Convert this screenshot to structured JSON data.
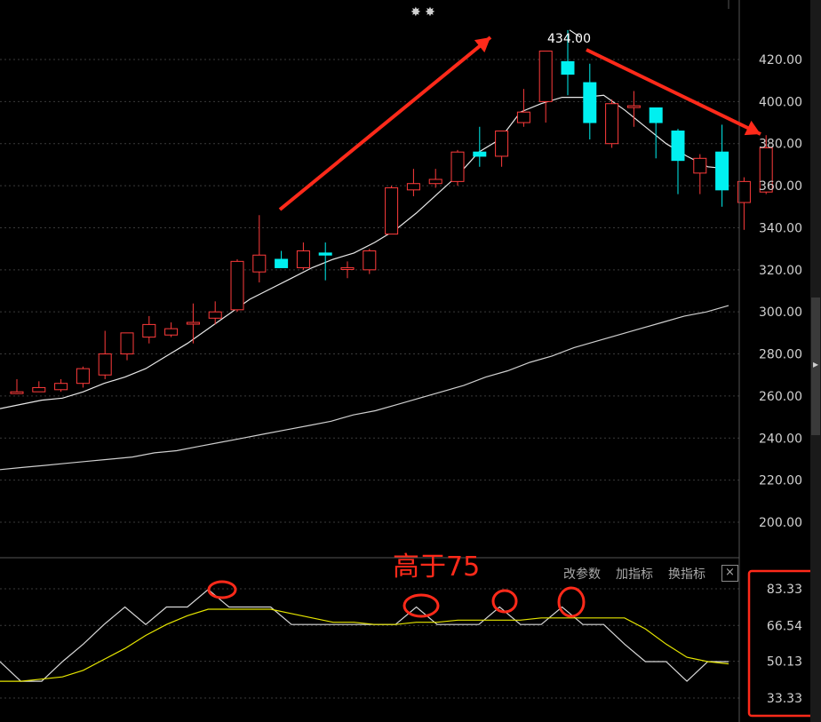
{
  "chart_data": [
    {
      "type": "candlestick",
      "ylim": [
        180,
        440
      ],
      "y_ticks": [
        "420.00",
        "400.00",
        "380.00",
        "360.00",
        "340.00",
        "320.00",
        "300.00",
        "280.00",
        "260.00",
        "240.00",
        "220.00",
        "200.00"
      ],
      "max_label": "434.00",
      "candles": [
        {
          "o": 262,
          "h": 268,
          "l": 261,
          "c": 262
        },
        {
          "o": 262,
          "h": 267,
          "l": 262,
          "c": 264
        },
        {
          "o": 263,
          "h": 268,
          "l": 262,
          "c": 266
        },
        {
          "o": 266,
          "h": 274,
          "l": 264,
          "c": 273
        },
        {
          "o": 270,
          "h": 291,
          "l": 268,
          "c": 280
        },
        {
          "o": 280,
          "h": 288,
          "l": 277,
          "c": 290
        },
        {
          "o": 288,
          "h": 298,
          "l": 285,
          "c": 294
        },
        {
          "o": 289,
          "h": 295,
          "l": 288,
          "c": 292
        },
        {
          "o": 295,
          "h": 304,
          "l": 285,
          "c": 295
        },
        {
          "o": 297,
          "h": 305,
          "l": 294,
          "c": 300
        },
        {
          "o": 301,
          "h": 325,
          "l": 300,
          "c": 324
        },
        {
          "o": 319,
          "h": 346,
          "l": 314,
          "c": 327
        },
        {
          "o": 325,
          "h": 329,
          "l": 321,
          "c": 321
        },
        {
          "o": 321,
          "h": 333,
          "l": 320,
          "c": 329
        },
        {
          "o": 328,
          "h": 333,
          "l": 315,
          "c": 327
        },
        {
          "o": 321,
          "h": 324,
          "l": 316,
          "c": 321
        },
        {
          "o": 320,
          "h": 330,
          "l": 318,
          "c": 329
        },
        {
          "o": 337,
          "h": 360,
          "l": 337,
          "c": 359
        },
        {
          "o": 358,
          "h": 368,
          "l": 355,
          "c": 361
        },
        {
          "o": 361,
          "h": 368,
          "l": 359,
          "c": 363
        },
        {
          "o": 362,
          "h": 377,
          "l": 360,
          "c": 376
        },
        {
          "o": 376,
          "h": 388,
          "l": 369,
          "c": 374
        },
        {
          "o": 374,
          "h": 386,
          "l": 369,
          "c": 386
        },
        {
          "o": 390,
          "h": 406,
          "l": 388,
          "c": 395
        },
        {
          "o": 400,
          "h": 424,
          "l": 390,
          "c": 424
        },
        {
          "o": 419,
          "h": 434,
          "l": 403,
          "c": 413
        },
        {
          "o": 409,
          "h": 418,
          "l": 382,
          "c": 390
        },
        {
          "o": 380,
          "h": 401,
          "l": 378,
          "c": 399
        },
        {
          "o": 398,
          "h": 405,
          "l": 388,
          "c": 398
        },
        {
          "o": 397,
          "h": 397,
          "l": 373,
          "c": 390
        },
        {
          "o": 386,
          "h": 387,
          "l": 356,
          "c": 372
        },
        {
          "o": 366,
          "h": 375,
          "l": 356,
          "c": 373
        },
        {
          "o": 376,
          "h": 389,
          "l": 350,
          "c": 358
        },
        {
          "o": 352,
          "h": 364,
          "l": 339,
          "c": 362
        },
        {
          "o": 357,
          "h": 384,
          "l": 356,
          "c": 378
        }
      ],
      "ma_short": [
        254,
        256,
        258,
        259,
        262,
        266,
        269,
        273,
        279,
        285,
        292,
        299,
        306,
        311,
        316,
        321,
        325,
        328,
        333,
        339,
        347,
        356,
        365,
        376,
        382,
        395,
        399,
        402,
        402,
        403,
        396,
        388,
        380,
        374,
        369,
        368
      ],
      "ma_long": [
        225,
        226,
        227,
        228,
        229,
        230,
        231,
        233,
        234,
        236,
        238,
        240,
        242,
        244,
        246,
        248,
        251,
        253,
        256,
        259,
        262,
        265,
        269,
        272,
        276,
        279,
        283,
        286,
        289,
        292,
        295,
        298,
        300,
        303
      ]
    },
    {
      "type": "line",
      "ylim": [
        28,
        95
      ],
      "y_ticks": [
        "83.33",
        "66.54",
        "50.13",
        "33.33"
      ],
      "series": [
        {
          "color": "#d8d8d8",
          "values": [
            50,
            41,
            41,
            50,
            58,
            67,
            75,
            67,
            75,
            75,
            83,
            75,
            75,
            75,
            67,
            67,
            67,
            67,
            67,
            67,
            75,
            67,
            67,
            67,
            75,
            67,
            67,
            75,
            67,
            67,
            58,
            50,
            50,
            41,
            50,
            50
          ]
        },
        {
          "color": "#e6e600",
          "values": [
            41,
            41,
            42,
            43,
            46,
            51,
            56,
            62,
            67,
            71,
            74,
            74,
            74,
            74,
            72,
            70,
            68,
            68,
            67,
            67,
            68,
            68,
            69,
            69,
            69,
            69,
            70,
            70,
            70,
            70,
            70,
            65,
            58,
            52,
            50,
            49
          ]
        }
      ]
    }
  ],
  "toolbar": {
    "edit_params": "改参数",
    "add_indicator": "加指标",
    "swap_indicator": "换指标",
    "close_symbol": "×"
  },
  "annotation": {
    "text": "高于75"
  },
  "top_marks": "✸ ✸"
}
